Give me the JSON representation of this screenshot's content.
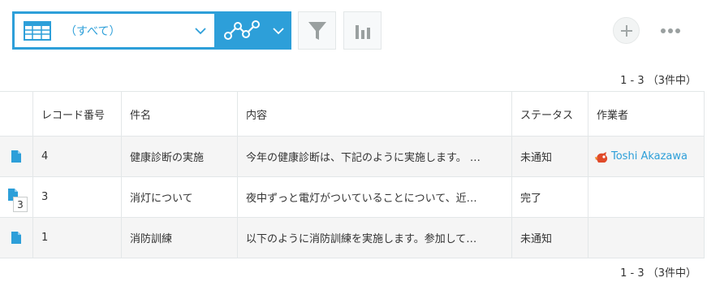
{
  "toolbar": {
    "view_label": "（すべて）",
    "icons": {
      "view": "table-icon",
      "graph": "graph-icon",
      "filter": "filter-icon",
      "chart": "bar-chart-icon",
      "add": "plus-icon",
      "more": "more-icon"
    },
    "accent": "#2d9fd9"
  },
  "pager": {
    "top": "1 - 3 （3件中）",
    "bottom": "1 - 3 （3件中）"
  },
  "table": {
    "headers": [
      "レコード番号",
      "件名",
      "内容",
      "ステータス",
      "作業者"
    ],
    "rows": [
      {
        "num": "4",
        "subject": "健康診断の実施",
        "content": "今年の健康診断は、下記のように実施します。 …",
        "status": "未通知",
        "worker": "Toshi Akazawa",
        "badge": ""
      },
      {
        "num": "3",
        "subject": "消灯について",
        "content": "夜中ずっと電灯がついていることについて、近…",
        "status": "完了",
        "worker": "",
        "badge": "3"
      },
      {
        "num": "1",
        "subject": "消防訓練",
        "content": "以下のように消防訓練を実施します。参加して…",
        "status": "未通知",
        "worker": "",
        "badge": ""
      }
    ]
  }
}
